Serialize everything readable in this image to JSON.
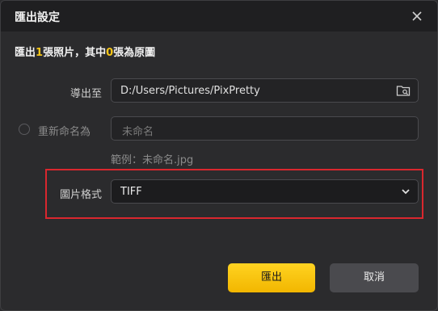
{
  "dialog": {
    "title": "匯出設定",
    "close_icon": "close-icon"
  },
  "summary": {
    "prefix": "匯出",
    "total": "1",
    "middle": "張照片，其中",
    "original_count": "0",
    "suffix": "張為原圖"
  },
  "export_to": {
    "label": "導出至",
    "value": "D:/Users/Pictures/PixPretty",
    "icon": "folder-icon"
  },
  "rename": {
    "label": "重新命名為",
    "placeholder": "未命名",
    "checked": false,
    "example": "範例：未命名.jpg"
  },
  "format": {
    "label": "圖片格式",
    "value": "TIFF",
    "icon": "chevron-down-icon"
  },
  "buttons": {
    "export": "匯出",
    "cancel": "取消"
  },
  "colors": {
    "accent": "#f5c518",
    "highlight_border": "#d9272e",
    "background": "#2b2b2d"
  }
}
